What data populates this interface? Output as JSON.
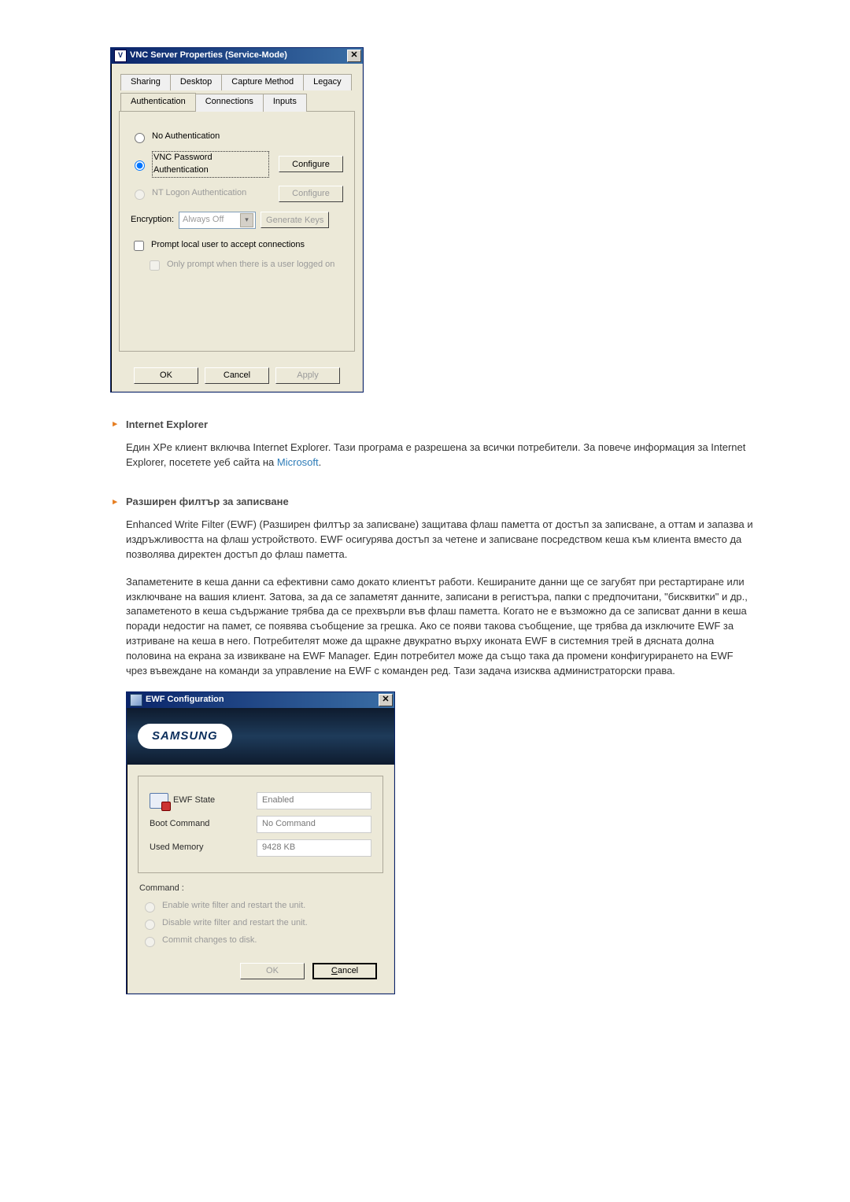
{
  "vnc_dialog": {
    "title": "VNC Server Properties (Service-Mode)",
    "tabs_row1": [
      "Sharing",
      "Desktop",
      "Capture Method",
      "Legacy"
    ],
    "tabs_row2": [
      "Authentication",
      "Connections",
      "Inputs"
    ],
    "active_tab": "Authentication",
    "radios": {
      "no_auth": "No Authentication",
      "vnc_pwd": "VNC Password Authentication",
      "nt_logon": "NT Logon Authentication"
    },
    "selected_radio": "vnc_pwd",
    "configure_btn": "Configure",
    "configure_btn_disabled": "Configure",
    "encryption_label": "Encryption:",
    "encryption_value": "Always Off",
    "generate_keys_btn": "Generate Keys",
    "chk_prompt": "Prompt local user to accept connections",
    "chk_only_prompt": "Only prompt when there is a user logged on",
    "buttons": {
      "ok": "OK",
      "cancel": "Cancel",
      "apply": "Apply"
    }
  },
  "sections": {
    "ie": {
      "title": "Internet Explorer",
      "body": "Един XPe клиент включва Internet Explorer. Тази програма е разрешена за всички потребители. За повече информация за Internet Explorer, посетете уеб сайта на ",
      "link_text": "Microsoft",
      "link_after": "."
    },
    "ewf_sec": {
      "title": "Разширен филтър за записване",
      "para1": "Enhanced Write Filter (EWF) (Разширен филтър за записване) защитава флаш паметта от достъп за записване, а оттам и запазва и издръжливостта на флаш устройството. EWF осигурява достъп за четене и записване посредством кеша към клиента вместо да позволява директен достъп до флаш паметта.",
      "para2": "Запаметените в кеша данни са ефективни само докато клиентът работи. Кешираните данни ще се загубят при рестартиране или изключване на вашия клиент. Затова, за да се запаметят данните, записани в регистъра, папки с предпочитани, \"бисквитки\" и др., запаметеното в кеша съдържание трябва да се прехвърли във флаш паметта. Когато не е възможно да се записват данни в кеша поради недостиг на памет, се появява съобщение за грешка. Ако се появи такова съобщение, ще трябва да изключите EWF за изтриване на кеша в него. Потребителят може да щракне двукратно върху иконата EWF в системния трей в дясната долна половина на екрана за извикване на EWF Manager. Един потребител може да също така да промени конфигурирането на EWF чрез въвеждане на команди за управление на EWF с команден ред. Тази задача изисква администраторски права."
    }
  },
  "ewf_dialog": {
    "title": "EWF Configuration",
    "brand": "SAMSUNG",
    "info": {
      "state_label": "EWF State",
      "state_value": "Enabled",
      "boot_label": "Boot Command",
      "boot_value": "No Command",
      "mem_label": "Used Memory",
      "mem_value": "9428 KB"
    },
    "command_label": "Command :",
    "radios": {
      "enable": "Enable write filter and restart the unit.",
      "disable": "Disable write filter and restart the unit.",
      "commit": "Commit changes to disk."
    },
    "buttons": {
      "ok": "OK",
      "cancel": "Cancel"
    }
  }
}
